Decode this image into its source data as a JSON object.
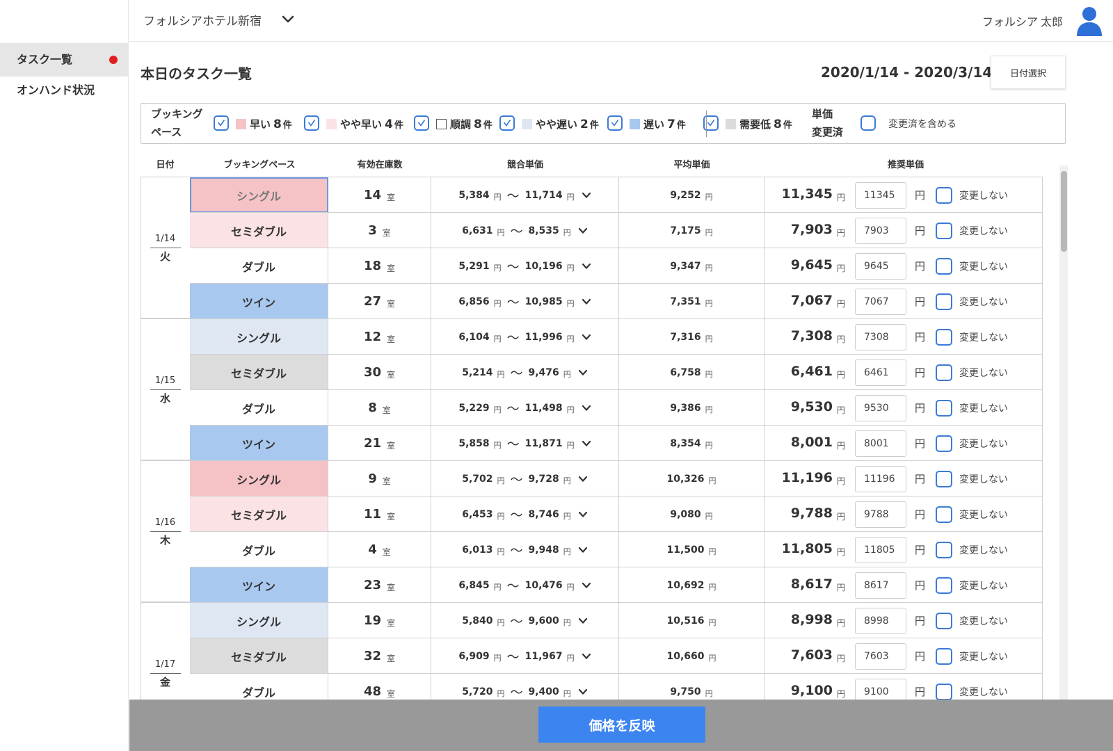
{
  "sidebar": {
    "items": [
      {
        "label": "タスク一覧",
        "active": true,
        "has_alert": true
      },
      {
        "label": "オンハンド状況",
        "active": false,
        "has_alert": false
      }
    ]
  },
  "header": {
    "hotel_name": "フォルシアホテル新宿",
    "user_last": "フォルシア",
    "user_first": "太郎"
  },
  "main": {
    "title": "本日のタスク一覧",
    "date_range": "2020/1/14 - 2020/3/14",
    "date_select_label": "日付選択"
  },
  "filters": {
    "group_label_1": "ブッキング",
    "group_label_2": "ペース",
    "items": [
      {
        "label": "早い",
        "count": "8",
        "unit": "件",
        "color": "#f5c3c6",
        "checked": true
      },
      {
        "label": "やや早い",
        "count": "4",
        "unit": "件",
        "color": "#fbe3e5",
        "checked": true
      },
      {
        "label": "順調",
        "count": "8",
        "unit": "件",
        "color": "#ffffff",
        "checked": true
      },
      {
        "label": "やや遅い",
        "count": "2",
        "unit": "件",
        "color": "#dfe7f2",
        "checked": true
      },
      {
        "label": "遅い",
        "count": "7",
        "unit": "件",
        "color": "#a9c8ef",
        "checked": true
      },
      {
        "label": "需要低",
        "count": "8",
        "unit": "件",
        "color": "#dcdcdc",
        "checked": true
      }
    ],
    "changed_label_1": "単価",
    "changed_label_2": "変更済",
    "include_changed_label": "変更済を含める"
  },
  "table": {
    "headers": {
      "date": "日付",
      "pace": "ブッキングペース",
      "stock": "有効在庫数",
      "competitor": "競合単価",
      "average": "平均単価",
      "recommended": "推奨単価"
    },
    "room_unit": "室",
    "yen": "円",
    "no_change_label": "変更しない",
    "days": [
      {
        "date": "1/14",
        "weekday": "火",
        "rows": [
          {
            "room": "シングル",
            "color": "#f5c3c6",
            "selected": true,
            "stock": "14",
            "comp_min": "5,384",
            "comp_max": "11,714",
            "avg": "9,252",
            "rec": "11,345",
            "input": "11345"
          },
          {
            "room": "セミダブル",
            "color": "#fbe3e5",
            "stock": "3",
            "comp_min": "6,631",
            "comp_max": "8,535",
            "avg": "7,175",
            "rec": "7,903",
            "input": "7903"
          },
          {
            "room": "ダブル",
            "color": "#ffffff",
            "stock": "18",
            "comp_min": "5,291",
            "comp_max": "10,196",
            "avg": "9,347",
            "rec": "9,645",
            "input": "9645"
          },
          {
            "room": "ツイン",
            "color": "#a9c8ef",
            "stock": "27",
            "comp_min": "6,856",
            "comp_max": "10,985",
            "avg": "7,351",
            "rec": "7,067",
            "input": "7067"
          }
        ]
      },
      {
        "date": "1/15",
        "weekday": "水",
        "rows": [
          {
            "room": "シングル",
            "color": "#dfe7f2",
            "stock": "12",
            "comp_min": "6,104",
            "comp_max": "11,996",
            "avg": "7,316",
            "rec": "7,308",
            "input": "7308"
          },
          {
            "room": "セミダブル",
            "color": "#dcdcdc",
            "stock": "30",
            "comp_min": "5,214",
            "comp_max": "9,476",
            "avg": "6,758",
            "rec": "6,461",
            "input": "6461"
          },
          {
            "room": "ダブル",
            "color": "#ffffff",
            "stock": "8",
            "comp_min": "5,229",
            "comp_max": "11,498",
            "avg": "9,386",
            "rec": "9,530",
            "input": "9530"
          },
          {
            "room": "ツイン",
            "color": "#a9c8ef",
            "stock": "21",
            "comp_min": "5,858",
            "comp_max": "11,871",
            "avg": "8,354",
            "rec": "8,001",
            "input": "8001"
          }
        ]
      },
      {
        "date": "1/16",
        "weekday": "木",
        "rows": [
          {
            "room": "シングル",
            "color": "#f5c3c6",
            "stock": "9",
            "comp_min": "5,702",
            "comp_max": "9,728",
            "avg": "10,326",
            "rec": "11,196",
            "input": "11196"
          },
          {
            "room": "セミダブル",
            "color": "#fbe3e5",
            "stock": "11",
            "comp_min": "6,453",
            "comp_max": "8,746",
            "avg": "9,080",
            "rec": "9,788",
            "input": "9788"
          },
          {
            "room": "ダブル",
            "color": "#ffffff",
            "stock": "4",
            "comp_min": "6,013",
            "comp_max": "9,948",
            "avg": "11,500",
            "rec": "11,805",
            "input": "11805"
          },
          {
            "room": "ツイン",
            "color": "#a9c8ef",
            "stock": "23",
            "comp_min": "6,845",
            "comp_max": "10,476",
            "avg": "10,692",
            "rec": "8,617",
            "input": "8617"
          }
        ]
      },
      {
        "date": "1/17",
        "weekday": "金",
        "rows": [
          {
            "room": "シングル",
            "color": "#dfe7f2",
            "stock": "19",
            "comp_min": "5,840",
            "comp_max": "9,600",
            "avg": "10,516",
            "rec": "8,998",
            "input": "8998"
          },
          {
            "room": "セミダブル",
            "color": "#dcdcdc",
            "stock": "32",
            "comp_min": "6,909",
            "comp_max": "11,967",
            "avg": "10,660",
            "rec": "7,603",
            "input": "7603"
          },
          {
            "room": "ダブル",
            "color": "#ffffff",
            "stock": "48",
            "comp_min": "5,720",
            "comp_max": "9,400",
            "avg": "9,750",
            "rec": "9,100",
            "input": "9100"
          }
        ]
      }
    ]
  },
  "footer": {
    "apply_label": "価格を反映"
  }
}
